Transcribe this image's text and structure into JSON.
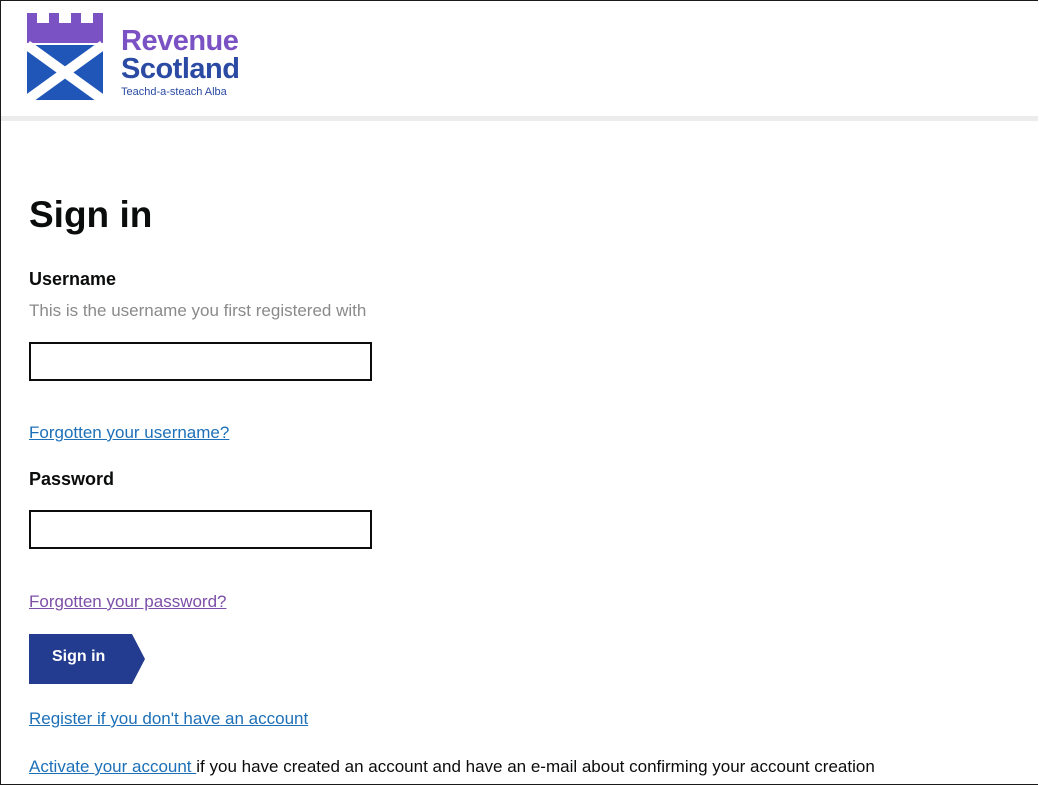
{
  "header": {
    "logo": {
      "line1": "Revenue",
      "line2": "Scotland",
      "tagline": "Teachd-a-steach Alba"
    }
  },
  "page": {
    "title": "Sign in"
  },
  "username": {
    "label": "Username",
    "hint": "This is the username you first registered with",
    "value": "",
    "forgot_link": "Forgotten your username?"
  },
  "password": {
    "label": "Password",
    "value": "",
    "forgot_link": "Forgotten your password?"
  },
  "actions": {
    "signin_label": "Sign in",
    "register_link": "Register if you don't have an account",
    "activate_link": "Activate your account ",
    "activate_suffix": "if you have created an account and have an e-mail about confirming your account creation"
  },
  "colors": {
    "brand_purple": "#7b52c4",
    "brand_blue": "#2b4aa3",
    "button": "#243c8f",
    "link": "#1d70b8",
    "link_visited": "#7d4fa8"
  }
}
